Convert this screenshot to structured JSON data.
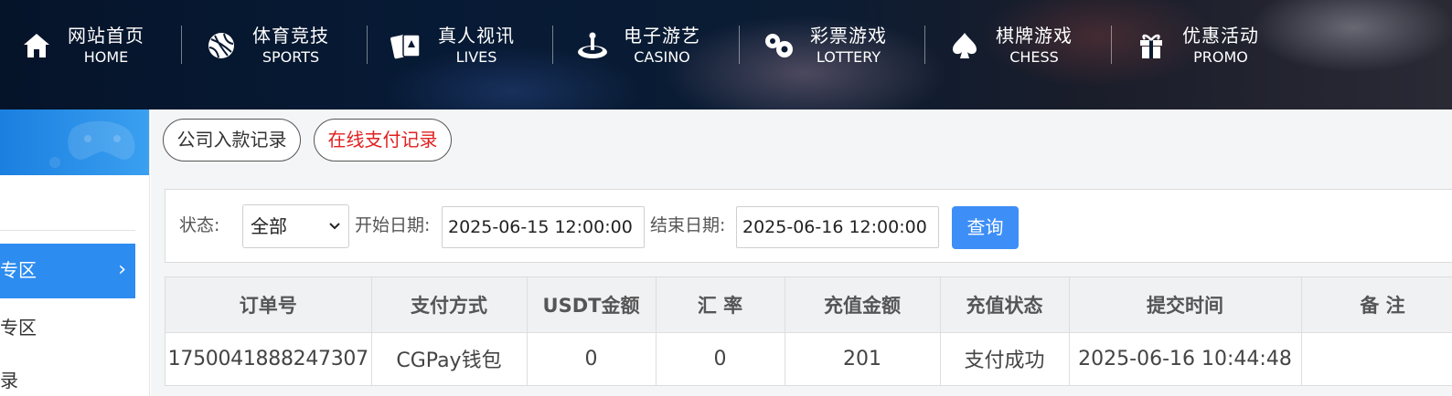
{
  "nav": {
    "items": [
      {
        "zh": "网站首页",
        "en": "HOME",
        "icon": "home-icon"
      },
      {
        "zh": "体育竞技",
        "en": "SPORTS",
        "icon": "ball-icon"
      },
      {
        "zh": "真人视讯",
        "en": "LIVES",
        "icon": "cards-icon"
      },
      {
        "zh": "电子游艺",
        "en": "CASINO",
        "icon": "roulette-icon"
      },
      {
        "zh": "彩票游戏",
        "en": "LOTTERY",
        "icon": "lottery-balls-icon"
      },
      {
        "zh": "棋牌游戏",
        "en": "CHESS",
        "icon": "spade-icon"
      },
      {
        "zh": "优惠活动",
        "en": "PROMO",
        "icon": "gift-icon"
      }
    ]
  },
  "sidebar": {
    "active_label": "专区",
    "active_chevron": "›",
    "item1": "专区",
    "item2": "录"
  },
  "tabs": {
    "company_deposit": "公司入款记录",
    "online_payment": "在线支付记录"
  },
  "filter": {
    "status_label": "状态:",
    "status_value": "全部",
    "start_label": "开始日期:",
    "start_value": "2025-06-15 12:00:00",
    "end_label": "结束日期:",
    "end_value": "2025-06-16 12:00:00",
    "query_button": "查询"
  },
  "table": {
    "headers": [
      "订单号",
      "支付方式",
      "USDT金额",
      "汇 率",
      "充值金额",
      "充值状态",
      "提交时间",
      "备 注"
    ],
    "rows": [
      [
        "1750041888247307",
        "CGPay钱包",
        "0",
        "0",
        "201",
        "支付成功",
        "2025-06-16 10:44:48",
        ""
      ]
    ]
  },
  "colors": {
    "accent": "#2d8cf0",
    "button": "#3e8ef7",
    "active_tab_text": "#e02020"
  }
}
